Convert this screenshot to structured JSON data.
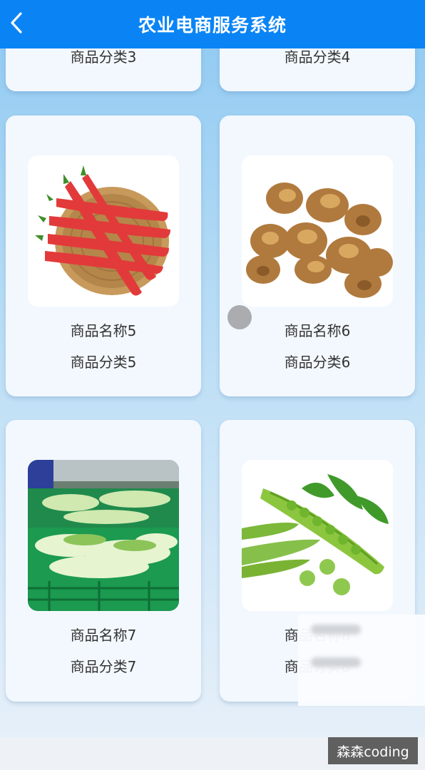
{
  "header": {
    "title": "农业电商服务系统"
  },
  "products": [
    {
      "category": "商品分类3"
    },
    {
      "category": "商品分类4"
    },
    {
      "name": "商品名称5",
      "category": "商品分类5"
    },
    {
      "name": "商品名称6",
      "category": "商品分类6"
    },
    {
      "name": "商品名称7",
      "category": "商品分类7"
    },
    {
      "name": "商品名称8",
      "category": "商品分类8"
    }
  ],
  "watermark": "森森coding",
  "icons": {
    "back": "chevron-left-icon"
  },
  "colors": {
    "header": "#0a84f5",
    "card": "#f3f8fe"
  }
}
